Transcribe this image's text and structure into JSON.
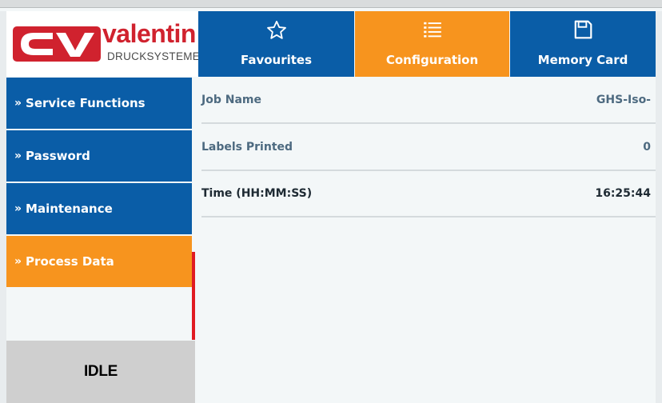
{
  "logo": {
    "brand": "valentin",
    "subtitle": "DRUCKSYSTEME",
    "accent": "#d0222e"
  },
  "tabs": [
    {
      "label": "Favourites",
      "icon": "star-outline-icon",
      "active": false
    },
    {
      "label": "Configuration",
      "icon": "list-icon",
      "active": true
    },
    {
      "label": "Memory Card",
      "icon": "floppy-disk-icon",
      "active": false
    }
  ],
  "sidebar": {
    "items": [
      {
        "label": "Service Functions",
        "icon": "double-chevron-right-icon",
        "active": false
      },
      {
        "label": "Password",
        "icon": "double-chevron-right-icon",
        "active": false
      },
      {
        "label": "Maintenance",
        "icon": "double-chevron-right-icon",
        "active": false
      },
      {
        "label": "Process Data",
        "icon": "double-chevron-right-icon",
        "active": true
      }
    ]
  },
  "status": {
    "text": "IDLE"
  },
  "process_data": {
    "rows": [
      {
        "label": "Job Name",
        "value": "GHS-Iso-"
      },
      {
        "label": "Labels Printed",
        "value": "0"
      },
      {
        "label": "Time (HH:MM:SS)",
        "value": "16:25:44"
      }
    ]
  },
  "colors": {
    "blue": "#0a5da7",
    "orange": "#f7941e",
    "label_text": "#4d6a80",
    "status_bg": "#cfcfcf",
    "indicator": "#e01b22"
  }
}
